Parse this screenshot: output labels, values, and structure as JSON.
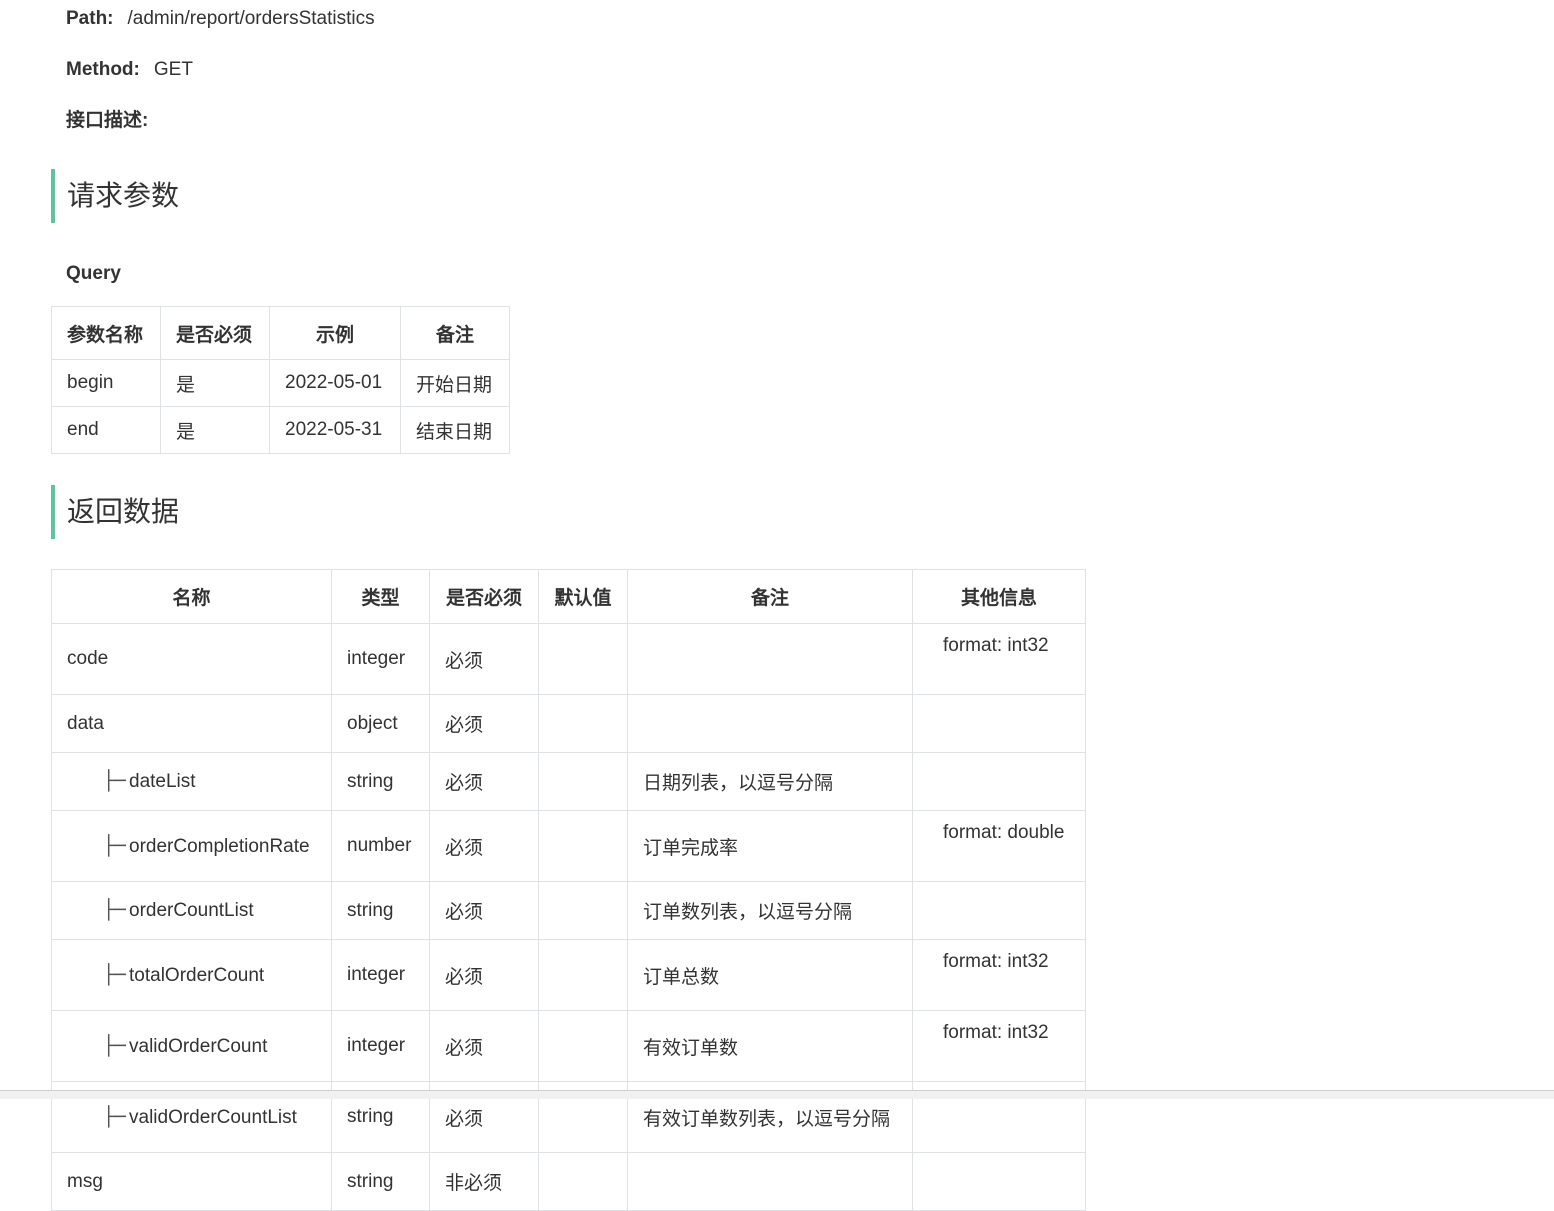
{
  "meta": {
    "path_label": "Path:",
    "path_value": "/admin/report/ordersStatistics",
    "method_label": "Method:",
    "method_value": "GET",
    "desc_label": "接口描述:"
  },
  "request_section": {
    "title": "请求参数",
    "query_label": "Query",
    "headers": [
      "参数名称",
      "是否必须",
      "示例",
      "备注"
    ],
    "rows": [
      [
        "begin",
        "是",
        "2022-05-01",
        "开始日期"
      ],
      [
        "end",
        "是",
        "2022-05-31",
        "结束日期"
      ]
    ]
  },
  "response_section": {
    "title": "返回数据",
    "headers": [
      "名称",
      "类型",
      "是否必须",
      "默认值",
      "备注",
      "其他信息"
    ],
    "rows": [
      {
        "name": "code",
        "child": false,
        "type": "integer",
        "required": "必须",
        "default": "",
        "note": "",
        "other": "format: int32"
      },
      {
        "name": "data",
        "child": false,
        "type": "object",
        "required": "必须",
        "default": "",
        "note": "",
        "other": ""
      },
      {
        "name": "dateList",
        "child": true,
        "type": "string",
        "required": "必须",
        "default": "",
        "note": "日期列表，以逗号分隔",
        "other": ""
      },
      {
        "name": "orderCompletionRate",
        "child": true,
        "type": "number",
        "required": "必须",
        "default": "",
        "note": "订单完成率",
        "other": "format: double"
      },
      {
        "name": "orderCountList",
        "child": true,
        "type": "string",
        "required": "必须",
        "default": "",
        "note": "订单数列表，以逗号分隔",
        "other": ""
      },
      {
        "name": "totalOrderCount",
        "child": true,
        "type": "integer",
        "required": "必须",
        "default": "",
        "note": "订单总数",
        "other": "format: int32"
      },
      {
        "name": "validOrderCount",
        "child": true,
        "type": "integer",
        "required": "必须",
        "default": "",
        "note": "有效订单数",
        "other": "format: int32"
      },
      {
        "name": "validOrderCountList",
        "child": true,
        "type": "string",
        "required": "必须",
        "default": "",
        "note": "有效订单数列表，以逗号分隔",
        "other": ""
      },
      {
        "name": "msg",
        "child": false,
        "type": "string",
        "required": "非必须",
        "default": "",
        "note": "",
        "other": ""
      }
    ],
    "tree_glyph": "├─"
  },
  "colors": {
    "accent": "#5cc59a",
    "border": "#dfe2e5",
    "text": "#333333"
  }
}
